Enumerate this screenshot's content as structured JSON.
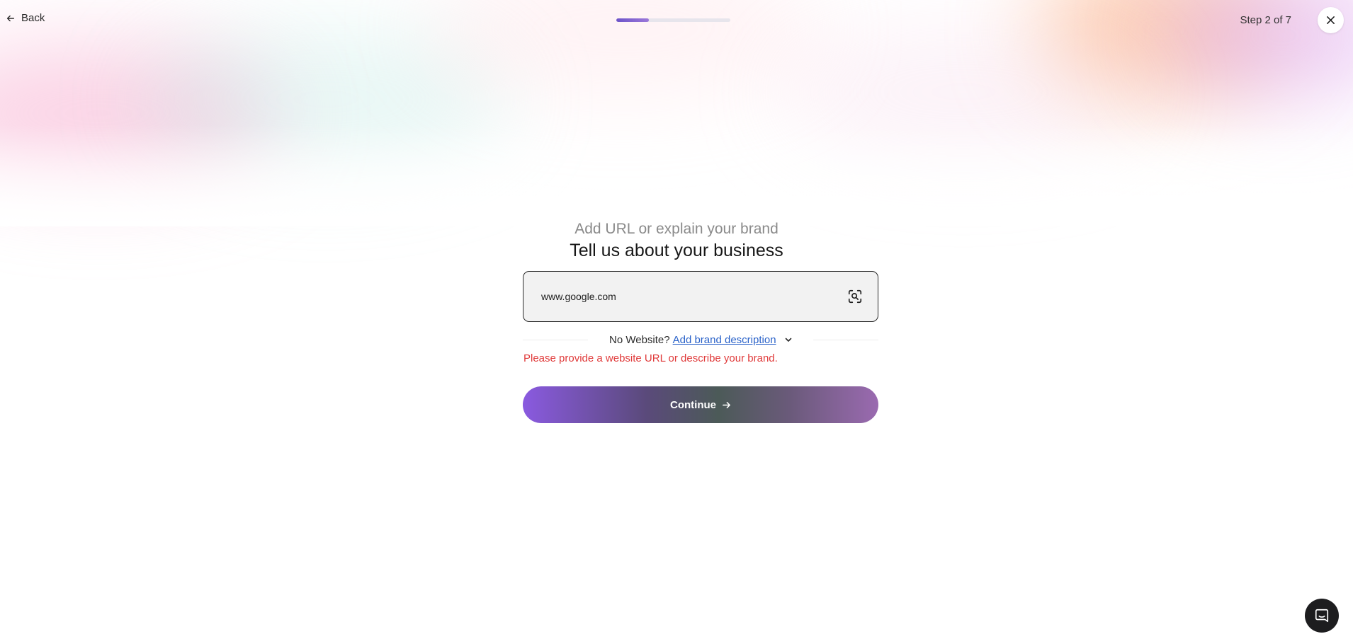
{
  "nav": {
    "back_label": "Back",
    "step_label": "Step 2 of 7",
    "progress_fraction": 0.2857
  },
  "header": {
    "subtitle": "Add URL or explain your brand",
    "title": "Tell us about your business"
  },
  "url_input": {
    "value": "www.google.com",
    "placeholder": ""
  },
  "no_website": {
    "prompt": "No Website?",
    "link_label": "Add brand description"
  },
  "error_message": "Please provide a website URL or describe your brand.",
  "continue_label": "Continue",
  "icons": {
    "back": "arrow-left-icon",
    "close": "close-icon",
    "scan": "scan-search-icon",
    "expand": "chevron-down-icon",
    "continue": "arrow-right-icon",
    "chat": "chat-icon"
  },
  "colors": {
    "error": "#e03a3a",
    "link": "#2a62c9",
    "progress": "#6d54c9"
  }
}
